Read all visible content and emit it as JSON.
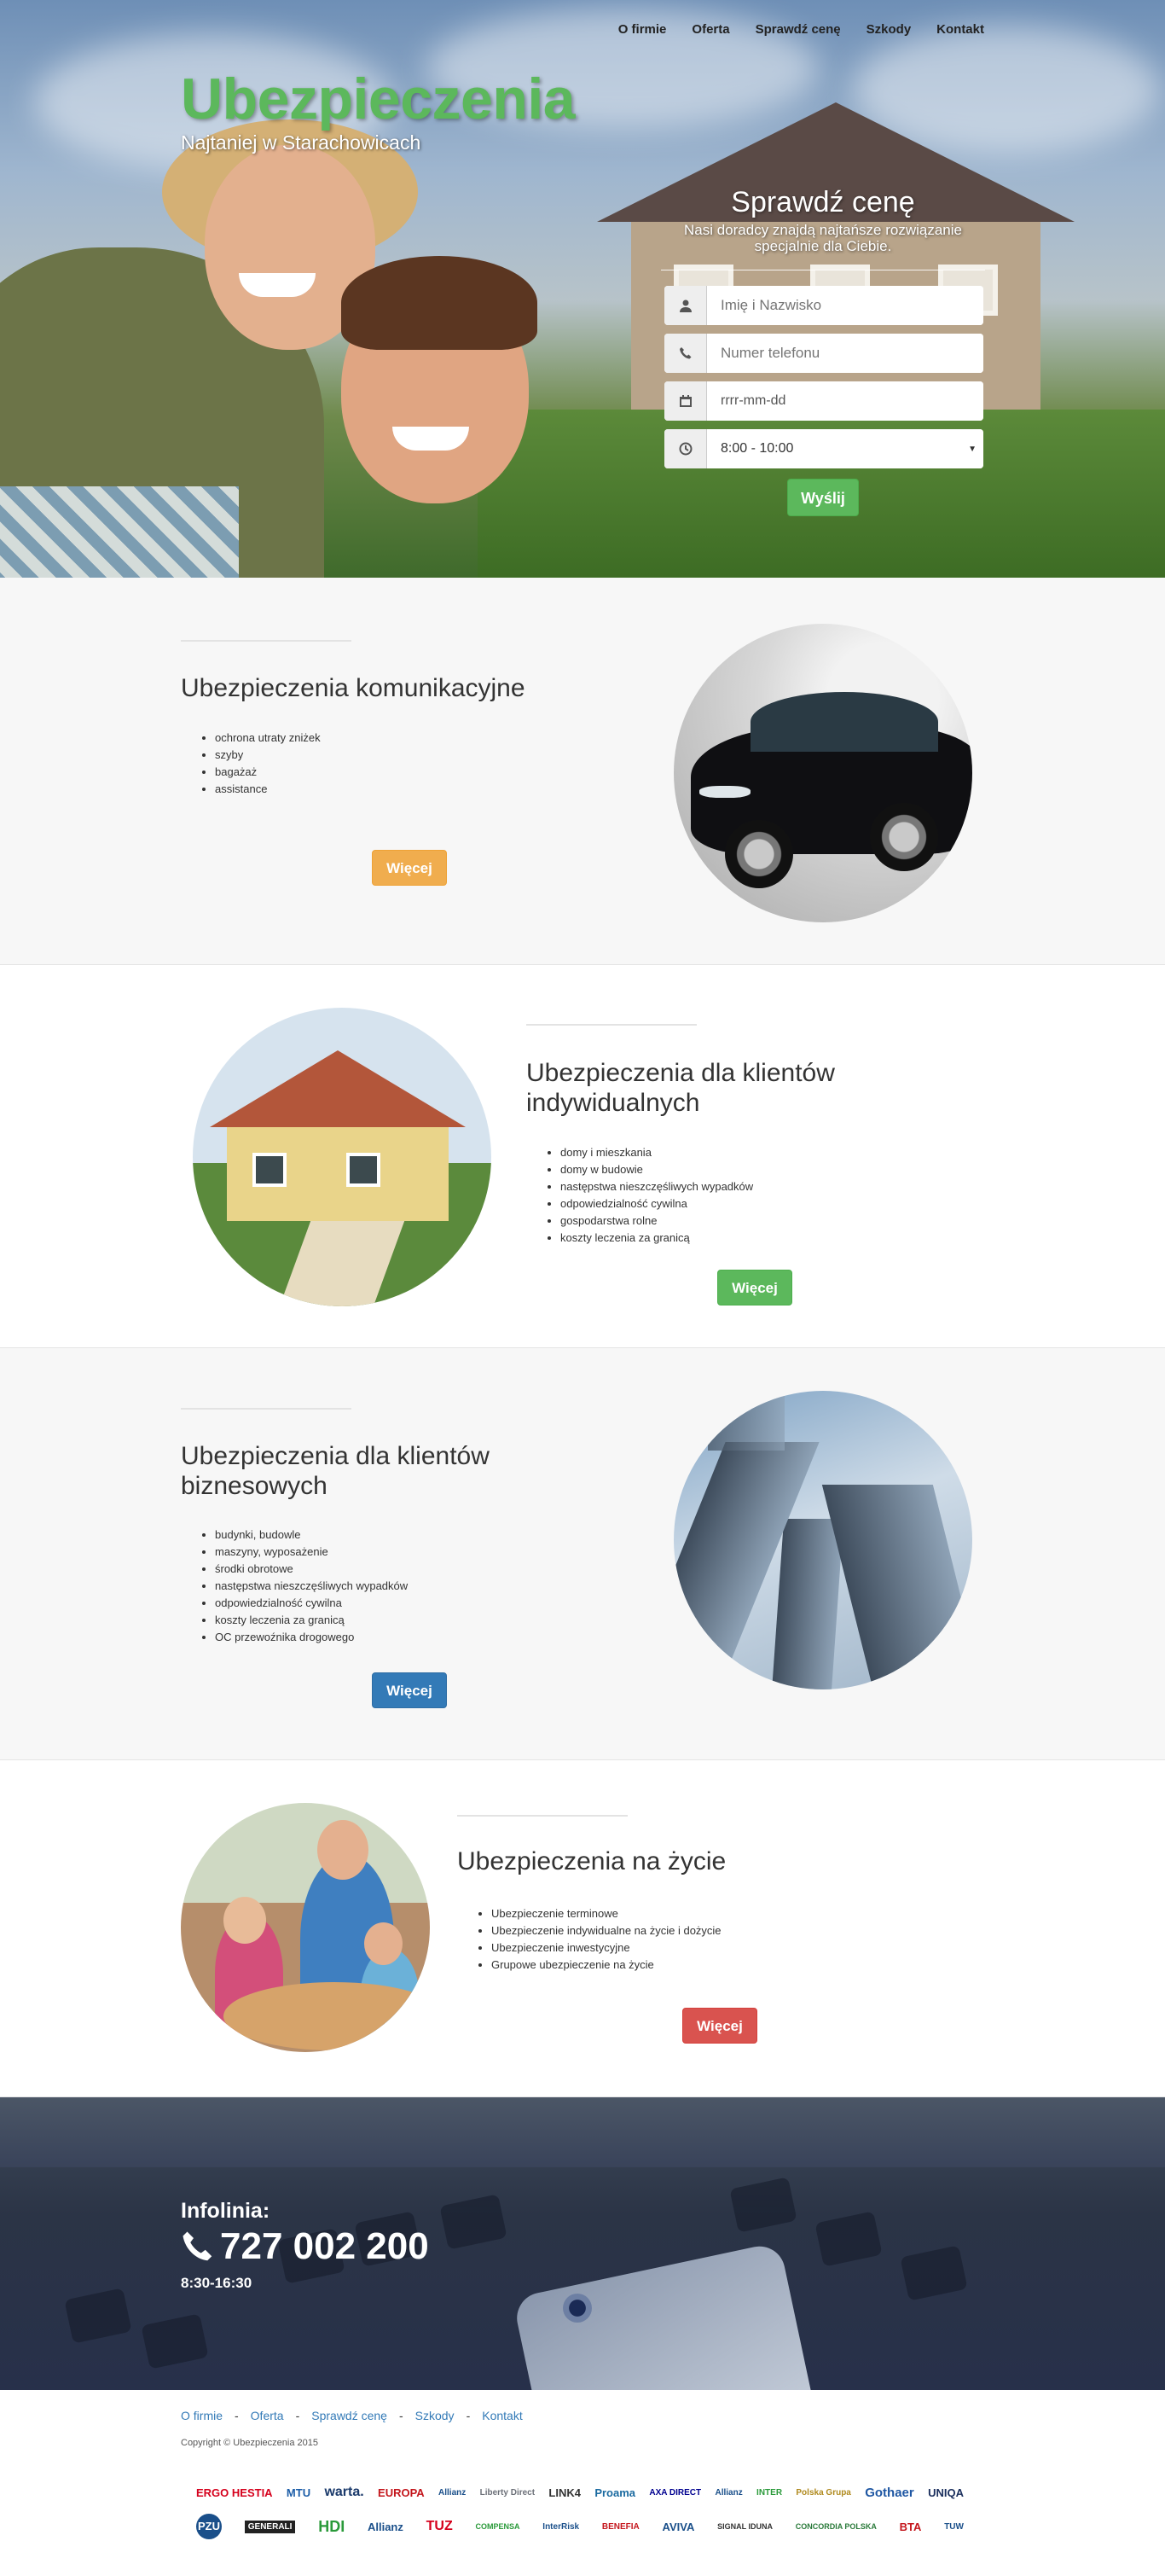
{
  "nav": [
    "O firmie",
    "Oferta",
    "Sprawdź cenę",
    "Szkody",
    "Kontakt"
  ],
  "hero": {
    "title": "Ubezpieczenia",
    "subtitle": "Najtaniej w Starachowicach"
  },
  "quote_form": {
    "title": "Sprawdź cenę",
    "subtitle_line1": "Nasi doradcy znajdą najtańsze rozwiązanie",
    "subtitle_line2": "specjalnie dla Ciebie.",
    "name_placeholder": "Imię i Nazwisko",
    "phone_placeholder": "Numer telefonu",
    "date_value": "rrrr-mm-dd",
    "time_value": "8:00 - 10:00",
    "submit": "Wyślij",
    "icons": [
      "user-icon",
      "phone-icon",
      "calendar-icon",
      "clock-icon"
    ]
  },
  "sections": [
    {
      "title": "Ubezpieczenia komunikacyjne",
      "items": [
        "ochrona utraty zniżek",
        "szyby",
        "bagażaż",
        "assistance"
      ],
      "button": "Więcej",
      "button_color": "#f0ad4e"
    },
    {
      "title_line1": "Ubezpieczenia dla klientów",
      "title_line2": "indywidualnych",
      "items": [
        "domy i mieszkania",
        "domy w budowie",
        "następstwa nieszczęśliwych wypadków",
        "odpowiedzialność cywilna",
        "gospodarstwa rolne",
        "koszty leczenia za granicą"
      ],
      "button": "Więcej",
      "button_color": "#5cb85c"
    },
    {
      "title_line1": "Ubezpieczenia dla klientów",
      "title_line2": "biznesowych",
      "items": [
        "budynki, budowle",
        "maszyny, wyposażenie",
        "środki obrotowe",
        "następstwa nieszczęśliwych wypadków",
        "odpowiedzialność cywilna",
        "koszty leczenia za granicą",
        "OC przewoźnika drogowego"
      ],
      "button": "Więcej",
      "button_color": "#337ab7"
    },
    {
      "title": "Ubezpieczenia na życie",
      "items": [
        "Ubezpieczenie terminowe",
        "Ubezpieczenie indywidualne na życie i dożycie",
        "Ubezpieczenie inwestycyjne",
        "Grupowe ubezpieczenie na życie"
      ],
      "button": "Więcej",
      "button_color": "#d9534f"
    }
  ],
  "infoline": {
    "label": "Infolinia:",
    "number": "727 002 200",
    "hours": "8:30-16:30"
  },
  "footer": {
    "links": [
      "O firmie",
      "Oferta",
      "Sprawdź cenę",
      "Szkody",
      "Kontakt"
    ],
    "separator": "-",
    "copyright": "Copyright © Ubezpieczenia 2015",
    "logos_row1": [
      "ERGO HESTIA",
      "MTU",
      "warta.",
      "EUROPA",
      "Allianz",
      "Liberty Direct",
      "LINK4",
      "Proama",
      "AXA DIRECT",
      "Allianz",
      "INTER",
      "Polska Grupa",
      "Gothaer",
      "UNIQA"
    ],
    "logos_row2": [
      "PZU",
      "GENERALI",
      "HDI",
      "Allianz",
      "TUZ",
      "COMPENSA",
      "InterRisk",
      "BENEFIA",
      "AVIVA",
      "SIGNAL IDUNA",
      "CONCORDIA POLSKA",
      "BTA",
      "TUW"
    ]
  }
}
